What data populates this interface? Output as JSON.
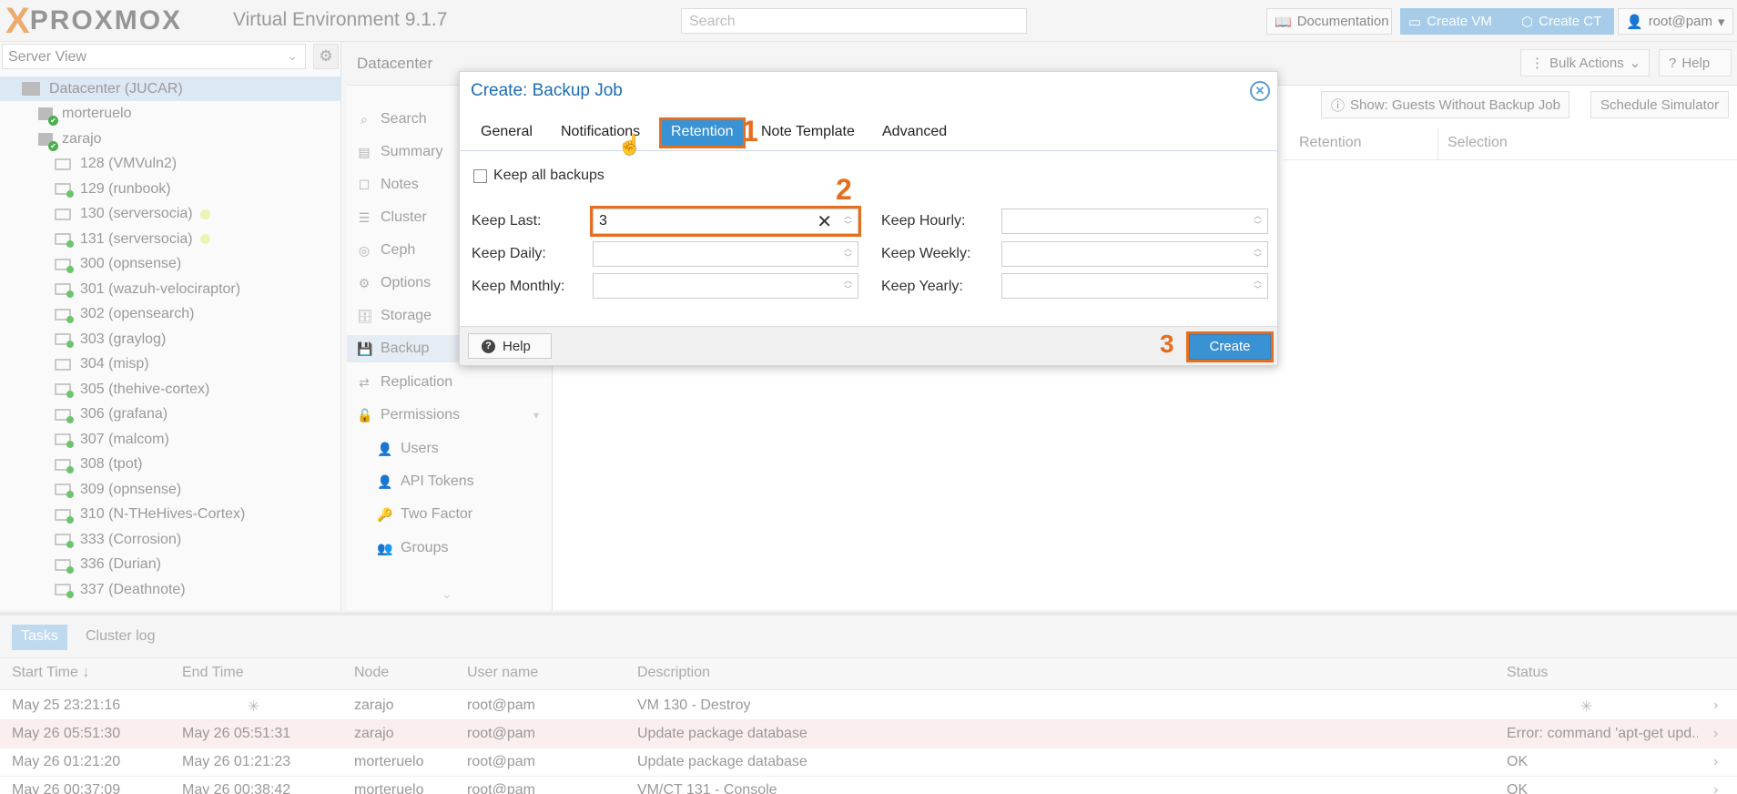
{
  "header": {
    "logo": "PROXMOX",
    "version": "Virtual Environment 9.1.7",
    "search_placeholder": "Search",
    "documentation": "Documentation",
    "create_vm": "Create VM",
    "create_ct": "Create CT",
    "user": "root@pam"
  },
  "left": {
    "view_selector": "Server View",
    "tree": [
      {
        "label": "Datacenter (JUCAR)",
        "type": "datacenter"
      },
      {
        "label": "morteruelo",
        "type": "node"
      },
      {
        "label": "zarajo",
        "type": "node"
      },
      {
        "label": "128 (VMVuln2)",
        "type": "vm-stopped"
      },
      {
        "label": "129 (runbook)",
        "type": "vm"
      },
      {
        "label": "130 (serversocia)",
        "type": "vm-stopped",
        "dot": true
      },
      {
        "label": "131 (serversocia)",
        "type": "vm",
        "dot": true
      },
      {
        "label": "300 (opnsense)",
        "type": "vm"
      },
      {
        "label": "301 (wazuh-velociraptor)",
        "type": "vm"
      },
      {
        "label": "302 (opensearch)",
        "type": "vm"
      },
      {
        "label": "303 (graylog)",
        "type": "vm"
      },
      {
        "label": "304 (misp)",
        "type": "vm-stopped"
      },
      {
        "label": "305 (thehive-cortex)",
        "type": "vm"
      },
      {
        "label": "306 (grafana)",
        "type": "vm"
      },
      {
        "label": "307 (malcom)",
        "type": "vm"
      },
      {
        "label": "308 (tpot)",
        "type": "vm"
      },
      {
        "label": "309 (opnsense)",
        "type": "vm"
      },
      {
        "label": "310 (N-THeHives-Cortex)",
        "type": "vm"
      },
      {
        "label": "333 (Corrosion)",
        "type": "vm"
      },
      {
        "label": "336 (Durian)",
        "type": "vm"
      },
      {
        "label": "337 (Deathnote)",
        "type": "vm"
      }
    ]
  },
  "content": {
    "breadcrumb": "Datacenter",
    "bulk_actions": "Bulk Actions",
    "help": "Help",
    "show_guests": "Show: Guests Without Backup Job",
    "schedule_sim": "Schedule Simulator",
    "col_retention": "Retention",
    "col_selection": "Selection",
    "nav": [
      "Search",
      "Summary",
      "Notes",
      "Cluster",
      "Ceph",
      "Options",
      "Storage",
      "Backup",
      "Replication",
      "Permissions",
      "Users",
      "API Tokens",
      "Two Factor",
      "Groups"
    ]
  },
  "dialog": {
    "title": "Create: Backup Job",
    "tabs": [
      "General",
      "Notifications",
      "Retention",
      "Note Template",
      "Advanced"
    ],
    "active_tab": "Retention",
    "keep_all_label": "Keep all backups",
    "keep_last_label": "Keep Last:",
    "keep_last_value": "3",
    "keep_hourly_label": "Keep Hourly:",
    "keep_daily_label": "Keep Daily:",
    "keep_weekly_label": "Keep Weekly:",
    "keep_monthly_label": "Keep Monthly:",
    "keep_yearly_label": "Keep Yearly:",
    "help": "Help",
    "create": "Create",
    "annotations": [
      "1",
      "2",
      "3"
    ]
  },
  "bottom": {
    "tabs": [
      "Tasks",
      "Cluster log"
    ],
    "columns": [
      "Start Time ↓",
      "End Time",
      "Node",
      "User name",
      "Description",
      "Status"
    ],
    "rows": [
      {
        "start": "May 25 23:21:16",
        "end": "",
        "node": "zarajo",
        "user": "root@pam",
        "desc": "VM 130 - Destroy",
        "status": "",
        "running": true
      },
      {
        "start": "May 26 05:51:30",
        "end": "May 26 05:51:31",
        "node": "zarajo",
        "user": "root@pam",
        "desc": "Update package database",
        "status": "Error: command 'apt-get upd...",
        "error": true
      },
      {
        "start": "May 26 01:21:20",
        "end": "May 26 01:21:23",
        "node": "morteruelo",
        "user": "root@pam",
        "desc": "Update package database",
        "status": "OK"
      },
      {
        "start": "May 26 00:37:09",
        "end": "May 26 00:38:42",
        "node": "morteruelo",
        "user": "root@pam",
        "desc": "VM/CT 131 - Console",
        "status": "OK"
      }
    ]
  },
  "colors": {
    "accent": "#3892d4",
    "annotation": "#e66e1c",
    "title": "#1c6db4"
  }
}
